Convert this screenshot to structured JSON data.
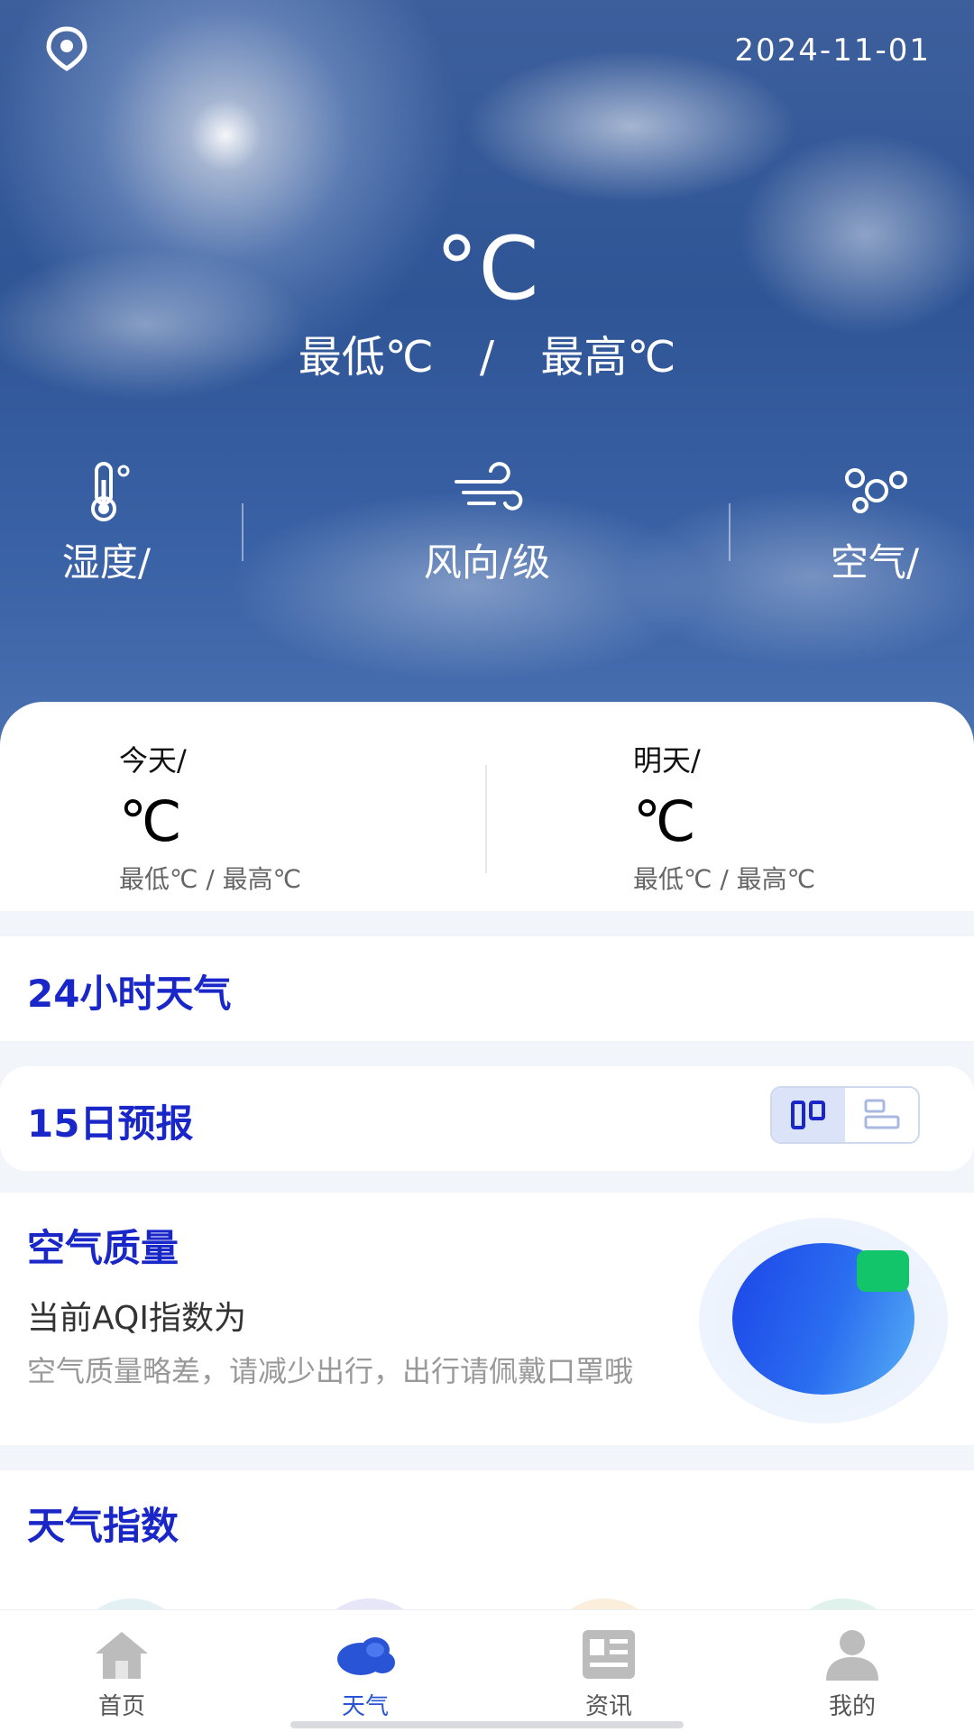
{
  "header": {
    "date": "2024-11-01",
    "location_icon": "location-pin-icon"
  },
  "current": {
    "temperature": "°C",
    "low": "最低℃",
    "separator": "/",
    "high": "最高℃"
  },
  "metrics": [
    {
      "icon": "thermometer-icon",
      "label": "湿度/"
    },
    {
      "icon": "wind-icon",
      "label": "风向/级"
    },
    {
      "icon": "air-bubbles-icon",
      "label": "空气/"
    }
  ],
  "days": {
    "today": {
      "label": "今天/",
      "temp": "℃",
      "range": "最低℃ / 最高℃"
    },
    "tomorrow": {
      "label": "明天/",
      "temp": "℃",
      "range": "最低℃ / 最高℃"
    }
  },
  "sections": {
    "hourly_title": "24小时天气",
    "forecast_title": "15日预报",
    "aqi_title": "空气质量",
    "aqi_subtitle": "当前AQI指数为",
    "aqi_desc": "空气质量略差，请减少出行，出行请佩戴口罩哦",
    "index_title": "天气指数"
  },
  "colors": {
    "accent": "#1a27c8",
    "tab_active": "#2a54d6",
    "aqi_badge": "#12c46a"
  },
  "tabs": [
    {
      "label": "首页",
      "icon": "home-icon",
      "active": false
    },
    {
      "label": "天气",
      "icon": "cloud-icon",
      "active": true
    },
    {
      "label": "资讯",
      "icon": "news-icon",
      "active": false
    },
    {
      "label": "我的",
      "icon": "user-icon",
      "active": false
    }
  ]
}
